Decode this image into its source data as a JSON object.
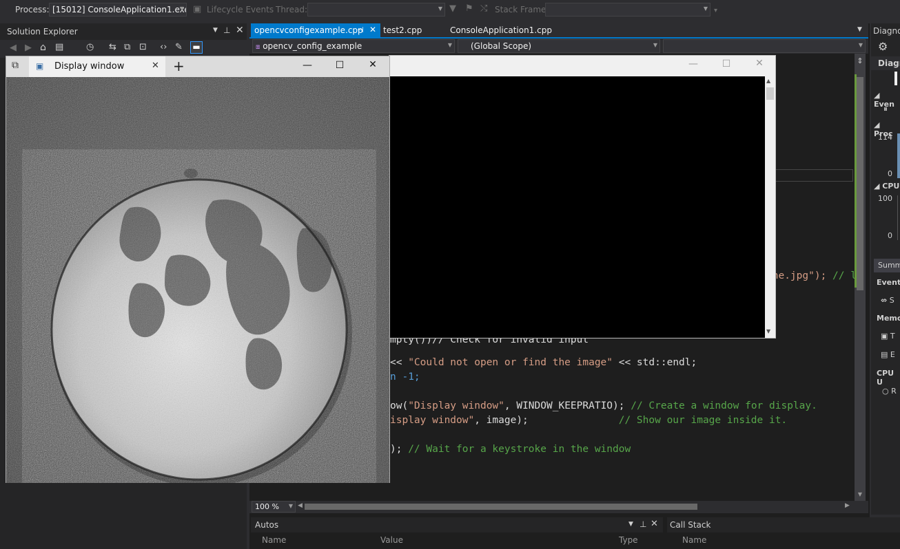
{
  "toolbar": {
    "process_label": "Process:",
    "process_value": "[15012] ConsoleApplication1.exe",
    "lifecycle_label": "Lifecycle Events",
    "thread_label": "Thread:",
    "stackframe_label": "Stack Frame:"
  },
  "solution_explorer": {
    "title": "Solution Explorer"
  },
  "editor": {
    "tabs": [
      {
        "label": "opencvconfigexample.cpp",
        "active": true
      },
      {
        "label": "test2.cpp",
        "active": false
      },
      {
        "label": "ConsoleApplication1.cpp",
        "active": false
      }
    ],
    "project_combo": "opencv_config_example",
    "scope_combo": "(Global Scope)",
    "zoom": "100 %",
    "code_fragments": {
      "line1_str": "une.jpg\");",
      "line1_cmt": "// l",
      "line2": "mpty())// Check for invalid input",
      "line3_op": "<< ",
      "line3_str": "\"Could not open or find the image\"",
      "line3_end": " << std::endl;",
      "line4": "n -1;",
      "line5_a": "ow(",
      "line5_str": "\"Display window\"",
      "line5_b": ", WINDOW_KEEPRATIO); ",
      "line5_cmt": "// Create a window for display.",
      "line6_str": "isplay window\"",
      "line6_b": ", image);               ",
      "line6_cmt": "// Show our image inside it.",
      "line7_a": "); ",
      "line7_cmt": "// Wait for a keystroke in the window"
    }
  },
  "display_window": {
    "title": "Display window",
    "new_tab": "+"
  },
  "diagnostics": {
    "title": "Diagno",
    "sub": "Diagn",
    "events": "Even",
    "process": "Proc",
    "proc_max": "114",
    "proc_min": "0",
    "cpu": "CPU",
    "cpu_max": "100",
    "cpu_min": "0",
    "summary_tab": "Summ",
    "events2": "Events",
    "events2_item": "S",
    "memory": "Memo",
    "memory_item1": "T",
    "memory_item2": "E",
    "cpu_usage": "CPU U",
    "cpu_usage_item": "R"
  },
  "autos": {
    "title": "Autos",
    "col_name": "Name",
    "col_value": "Value",
    "col_type": "Type"
  },
  "callstack": {
    "title": "Call Stack",
    "col_name": "Name"
  }
}
